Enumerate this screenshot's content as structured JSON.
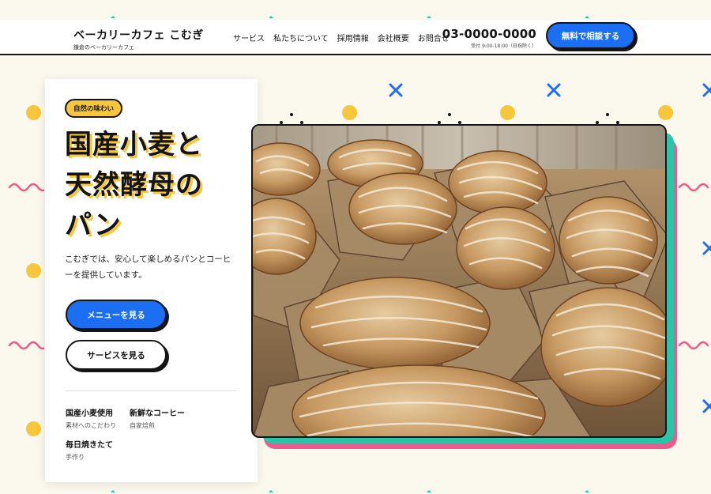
{
  "brand": {
    "name": "ベーカリーカフェ こむぎ",
    "tagline": "鎌倉のベーカリーカフェ"
  },
  "nav": {
    "items": [
      {
        "label": "サービス"
      },
      {
        "label": "私たちについて"
      },
      {
        "label": "採用情報"
      },
      {
        "label": "会社概要"
      },
      {
        "label": "お問合せ"
      }
    ]
  },
  "contact": {
    "phone": "03-0000-0000",
    "hours": "受付 9:00-18:00（日祝除く）",
    "cta_label": "無料で相談する"
  },
  "hero": {
    "badge": "自然の味わい",
    "headline_lines": [
      "国産小麦と",
      "天然酵母の",
      "パン"
    ],
    "lead": "こむぎでは、安心して楽しめるパンとコーヒーを提供しています。",
    "primary_button": "メニューを見る",
    "secondary_button": "サービスを見る",
    "features": [
      {
        "title": "国産小麦使用",
        "sub": "素材へのこだわり"
      },
      {
        "title": "新鮮なコーヒー",
        "sub": "自家焙煎"
      },
      {
        "title": "毎日焼きたて",
        "sub": "手作り"
      }
    ]
  },
  "colors": {
    "accent_yellow": "#f7c73b",
    "accent_blue": "#1c6ef2",
    "accent_pink": "#ee5a8b",
    "accent_teal": "#2cc4a9",
    "background": "#fbf8ee",
    "ink": "#141414"
  },
  "icons": {
    "phone": "phone-icon",
    "cross": "cross-icon",
    "wave": "wave-icon"
  }
}
